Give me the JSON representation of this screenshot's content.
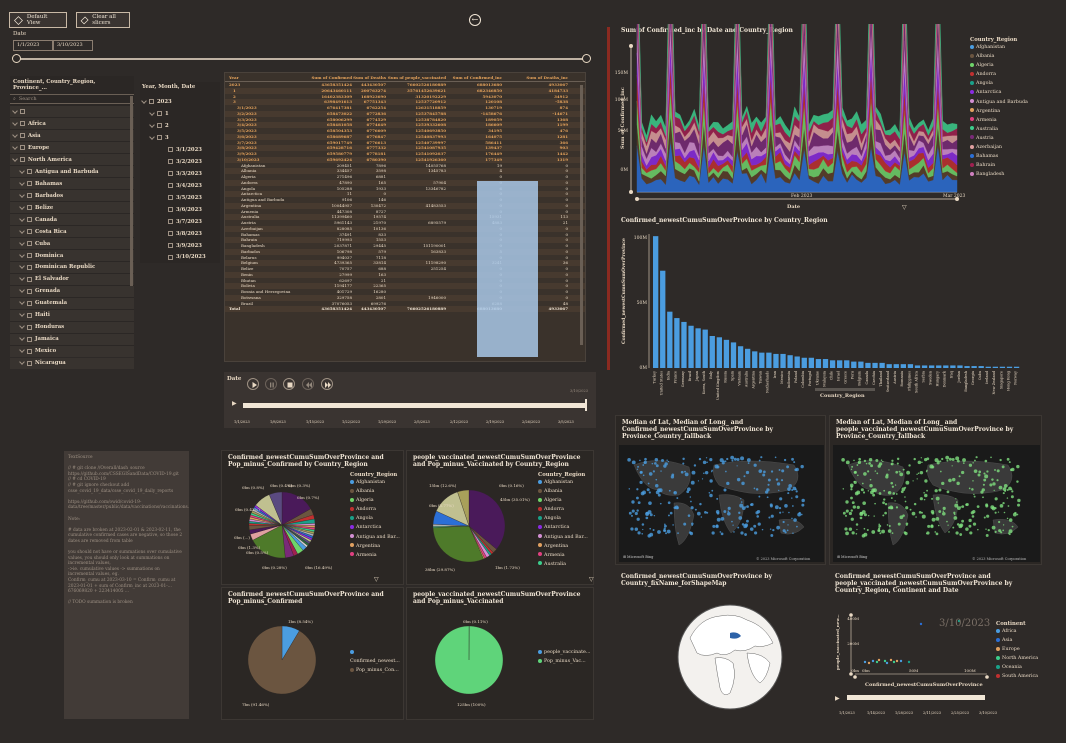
{
  "buttons": {
    "default_view": "Default View",
    "clear_filters": "Clear all slicers"
  },
  "date_filter": {
    "label": "Date",
    "start": "1/1/2023",
    "end": "3/10/2023"
  },
  "slicer_geo": {
    "header": "Continent, Country_Region, Province_...",
    "search_placeholder": "Search",
    "items": [
      "Africa",
      "Asia",
      "Europe",
      "North America",
      "Antigua and Barbuda",
      "Bahamas",
      "Barbados",
      "Belize",
      "Canada",
      "Costa Rica",
      "Cuba",
      "Dominica",
      "Dominican Republic",
      "El Salvador",
      "Grenada",
      "Guatemala",
      "Haiti",
      "Honduras",
      "Jamaica",
      "Mexico",
      "Nicaragua"
    ]
  },
  "slicer_date": {
    "header": "Year, Month, Date",
    "items": [
      "2023",
      "1",
      "2",
      "3",
      "3/1/2023",
      "3/2/2023",
      "3/3/2023",
      "3/4/2023",
      "3/5/2023",
      "3/6/2023",
      "3/7/2023",
      "3/8/2023",
      "3/9/2023",
      "3/10/2023"
    ]
  },
  "matrix": {
    "headers": [
      "Year",
      "Sum of Confirmed",
      "Sum of Deaths",
      "Sum of people_vaccinated",
      "Sum of Confirmed_inc",
      "Sum of Deaths_inc"
    ],
    "rows": [
      [
        "2023",
        "43658351424",
        "443430507",
        "76602526180889",
        "688013680",
        "4933067"
      ],
      [
        "1",
        "20643460111",
        "200763274",
        "35761452639621",
        "682346850",
        "4184733"
      ],
      [
        "2",
        "16402383309",
        "168923690",
        "31320192229",
        "5943070",
        "34912"
      ],
      [
        "3",
        "6398491613",
        "67751343",
        "12537720912",
        "120108",
        "-5838"
      ],
      [
        "3/1/2023",
        "676417381",
        "6762254",
        "12631518859",
        "130719",
        "874"
      ],
      [
        "3/2/2023",
        "658473022",
        "6772836",
        "12537845788",
        "-1458676",
        "-14671"
      ],
      [
        "3/3/2023",
        "658006299",
        "6774529",
        "12538784820",
        "189059",
        "1368"
      ],
      [
        "3/4/2023",
        "658481058",
        "6774649",
        "12539332608",
        "186609",
        "1199"
      ],
      [
        "3/5/2023",
        "658504353",
        "6776609",
        "12540693850",
        "34195",
        "476"
      ],
      [
        "3/6/2023",
        "658689687",
        "6776847",
        "12540837993",
        "164075",
        "1281"
      ],
      [
        "3/7/2023",
        "659017749",
        "6776613",
        "12540739997",
        "586411",
        "366"
      ],
      [
        "3/8/2023",
        "659428716",
        "6777332",
        "12541087935",
        "139437",
        "903"
      ],
      [
        "3/9/2023",
        "659580779",
        "6778181",
        "12541092037",
        "176449",
        "1442"
      ],
      [
        "3/10/2023",
        "659692424",
        "6780390",
        "12541926360",
        "177349",
        "1319"
      ],
      [
        "Afghanistan",
        "209451",
        "7896",
        "14055768",
        "19",
        "0"
      ],
      [
        "Albania",
        "334457",
        "3598",
        "1345783",
        "4",
        "0"
      ],
      [
        "Algeria",
        "271496",
        "6881",
        "",
        "0",
        "0"
      ],
      [
        "Andorra",
        "47890",
        "165",
        "57904",
        "0",
        "0"
      ],
      [
        "Angola",
        "105288",
        "1933",
        "13346782",
        "6",
        "0"
      ],
      [
        "Antarctica",
        "11",
        "0",
        "",
        "0",
        "0"
      ],
      [
        "Antigua and Barbuda",
        "9106",
        "146",
        "",
        "0",
        "0"
      ],
      [
        "Argentina",
        "10044957",
        "130472",
        "41483553",
        "0",
        "0"
      ],
      [
        "Armenia",
        "447308",
        "8727",
        "",
        "0",
        "0"
      ],
      [
        "Australia",
        "11399460",
        "19574",
        "",
        "15931",
        "113"
      ],
      [
        "Austria",
        "5961143",
        "21970",
        "6895579",
        "4883",
        "21"
      ],
      [
        "Azerbaijan",
        "828085",
        "10136",
        "",
        "0",
        "0"
      ],
      [
        "Bahamas",
        "37491",
        "833",
        "",
        "0",
        "0"
      ],
      [
        "Bahrain",
        "719993",
        "1553",
        "",
        "0",
        "0"
      ],
      [
        "Bangladesh",
        "2037871",
        "29445",
        "151190001",
        "0",
        "0"
      ],
      [
        "Barbados",
        "106798",
        "579",
        "163833",
        "5",
        "0"
      ],
      [
        "Belarus",
        "994037",
        "7118",
        "",
        "0",
        "0"
      ],
      [
        "Belgium",
        "4739365",
        "33814",
        "11198290",
        "3241",
        "36"
      ],
      [
        "Belize",
        "70757",
        "688",
        "251254",
        "0",
        "0"
      ],
      [
        "Benin",
        "27999",
        "163",
        "",
        "0",
        "0"
      ],
      [
        "Bhutan",
        "62697",
        "21",
        "",
        "0",
        "0"
      ],
      [
        "Bolivia",
        "1194177",
        "22365",
        "",
        "0",
        "0"
      ],
      [
        "Bosnia and Herzegovina",
        "401729",
        "16280",
        "",
        "0",
        "0"
      ],
      [
        "Botswana",
        "329758",
        "2801",
        "1946000",
        "0",
        "0"
      ],
      [
        "Brazil",
        "37076053",
        "699276",
        "",
        "6288",
        "48"
      ],
      [
        "Total",
        "43658351424",
        "443430507",
        "76602526180889",
        "688013680",
        "4933067"
      ]
    ]
  },
  "play_axis": {
    "label": "Date",
    "ticks": [
      "1/1/2023",
      "1/8/2023",
      "1/15/2023",
      "1/22/2023",
      "1/29/2023",
      "2/5/2023",
      "2/12/2023",
      "2/19/2023",
      "2/26/2023",
      "3/5/2023"
    ],
    "current": "3/10/2023"
  },
  "area_chart": {
    "title": "Sum of Confirmed_inc by Date and Country_Region",
    "ylabel": "Sum of Confirmed_inc",
    "xlabel": "Date",
    "yticks": [
      "150M",
      "100M",
      "50M",
      "0M"
    ],
    "xticks": [
      "Feb 2023",
      "Mar 2023"
    ],
    "legend_title": "Country_Region",
    "legend": [
      "Afghanistan",
      "Albania",
      "Algeria",
      "Andorra",
      "Angola",
      "Antarctica",
      "Antigua and Barbuda",
      "Argentina",
      "Armenia",
      "Australia",
      "Austria",
      "Azerbaijan",
      "Bahamas",
      "Bahrain",
      "Bangladesh"
    ]
  },
  "bar_chart": {
    "title": "Confirmed_newestCumuSumOverProvince by Country_Region",
    "ylabel": "Confirmed_newestCumuSumOverProvince",
    "xlabel": "Country_Region",
    "yticks": [
      "100M",
      "50M",
      "0M"
    ]
  },
  "map1": {
    "title": "Median of Lat, Median of Long_ and Confirmed_newestCumuSumOverProvince by Province_Country_fallback"
  },
  "map2": {
    "title": "Median of Lat, Median of Long_ and people_vaccinated_newestCumuSumOverProvince by Province_Country_fallback"
  },
  "credit": "© 2023 Microsoft Corporation",
  "pie1": {
    "title": "Confirmed_newestCumuSumOverProvince and Pop_minus_Confirmed by Country_Region",
    "labels": [
      "0bn (0.8%)",
      "0bn (0.4%)",
      "0bn (0.3%)",
      "0bn (0.7%)",
      "0bn (0.42%)",
      "0bn (...)",
      "0bn (1.3%)",
      "0bn (0.5%)",
      "0bn (0.28%)",
      "0bn (16.49%)"
    ],
    "legend_title": "Country_Region",
    "legend": [
      "Afghanistan",
      "Albania",
      "Algeria",
      "Andorra",
      "Angola",
      "Antarctica",
      "Antigua and Bar...",
      "Argentina",
      "Armenia"
    ]
  },
  "pie2": {
    "title": "people_vaccinated_newestCumuSumOverProvince and Pop_minus_Vaccinated by Country_Region",
    "labels": [
      "15bn (12.6%)",
      "45bn (35.01%)",
      "0bn (5.77%)",
      "38bn (29.87%)",
      "1bn (1.73%)",
      "0bn (0.16%)"
    ],
    "legend_title": "Country_Region",
    "legend": [
      "Afghanistan",
      "Albania",
      "Algeria",
      "Andorra",
      "Angola",
      "Antarctica",
      "Antigua and Bar...",
      "Argentina",
      "Armenia",
      "Australia"
    ]
  },
  "pie3": {
    "title": "Confirmed_newestCumuSumOverProvince and Pop_minus_Confirmed",
    "labels": [
      "1bn (8.54%)",
      "7bn (91.46%)"
    ],
    "legend": [
      "Confirmed_newest...",
      "Pop_minus_Con..."
    ]
  },
  "pie4": {
    "title": "people_vaccinated_newestCumuSumOverProvince and Pop_minus_Vaccinated",
    "labels": [
      "0bn (0.11%)",
      "125bn (100%)"
    ],
    "legend": [
      "people_vaccinate...",
      "Pop_minus_Vac..."
    ]
  },
  "shape_map": {
    "title": "Confirmed_newestCumuSumOverProvince by Country_fixName_forShapeMap"
  },
  "scatter": {
    "title": "Confirmed_newestCumuSumOverProvince and people_vaccinated_newestCumuSumOverProvince by Country_Region, Continent and Date",
    "date_watermark": "3/10/2023",
    "ylabel": "people_vaccinated_new...",
    "xlabel": "Confirmed_newestCumuSumOverProvince",
    "yticks": [
      "400M",
      "200M",
      "0bn"
    ],
    "xticks": [
      "0bn",
      "50M",
      "100M"
    ],
    "legend_title": "Continent",
    "legend": [
      "Africa",
      "Asia",
      "Europe",
      "North America",
      "Oceania",
      "South America"
    ],
    "play_ticks": [
      "1/1/2023",
      "1/14/2023",
      "1/28/2023",
      "2/11/2023",
      "2/25/2023",
      "3/10/2023"
    ]
  },
  "notes": {
    "text": "TextSource\n\n// # git clone  //Overall/dash_source\nhttps://github.com/CSSEGISandData/COVID-19.git\n// # cd COVID-19\n// # git ignore checkout  add\ncsse_covid_19_data/csse_covid_19_daily_reports\n\nhttps://github.com/owid/covid-19-data/tree/master/public/data/vaccinations/vaccinations.csv\n\nNote:\n\n# data are broken at 2023-02-01 & 2023-02-11, the cumulative confirmed cases are negative, so those 2 dates are removed from table\n\nyou should not have or summations over cumulative values, you should only look at summations on incremental values,\n->ie. cumulative values -> summations on incremental values, eg.\nConfirm_cumu at 2023-03-10 = Confirm_cumu at 2023-01-01 + sum of Confirm_inc at 2023-01-...\n676069820 + 223414005 ...\n\n// TODO summation is broken"
  }
}
